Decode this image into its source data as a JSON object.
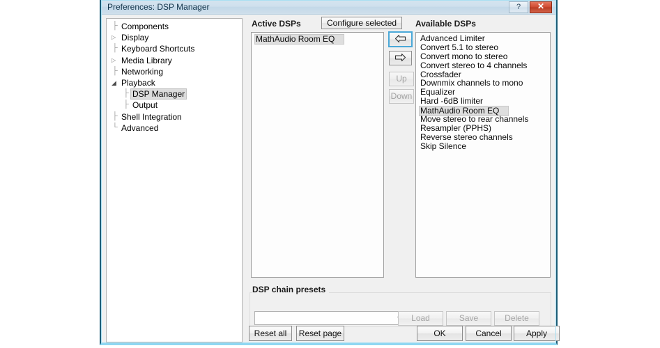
{
  "window": {
    "title": "Preferences: DSP Manager",
    "help_button": "?",
    "close_button": "✕"
  },
  "sidebar": {
    "items": [
      {
        "label": "Components",
        "glyph": "",
        "level": 0,
        "selected": false
      },
      {
        "label": "Display",
        "glyph": "collapsed",
        "level": 0,
        "selected": false
      },
      {
        "label": "Keyboard Shortcuts",
        "glyph": "",
        "level": 0,
        "selected": false
      },
      {
        "label": "Media Library",
        "glyph": "collapsed",
        "level": 0,
        "selected": false
      },
      {
        "label": "Networking",
        "glyph": "",
        "level": 0,
        "selected": false
      },
      {
        "label": "Playback",
        "glyph": "expanded",
        "level": 0,
        "selected": false
      },
      {
        "label": "DSP Manager",
        "glyph": "",
        "level": 1,
        "selected": true
      },
      {
        "label": "Output",
        "glyph": "",
        "level": 1,
        "selected": false
      },
      {
        "label": "Shell Integration",
        "glyph": "",
        "level": 0,
        "selected": false
      },
      {
        "label": "Advanced",
        "glyph": "",
        "level": 0,
        "selected": false
      }
    ]
  },
  "main": {
    "active_dsps": {
      "header": "Active DSPs",
      "configure_button": "Configure selected",
      "items": [
        {
          "label": "MathAudio Room EQ",
          "selected": true
        }
      ]
    },
    "available_dsps": {
      "header": "Available DSPs",
      "items": [
        {
          "label": "Advanced Limiter",
          "selected": false
        },
        {
          "label": "Convert 5.1 to stereo",
          "selected": false
        },
        {
          "label": "Convert mono to stereo",
          "selected": false
        },
        {
          "label": "Convert stereo to 4 channels",
          "selected": false
        },
        {
          "label": "Crossfader",
          "selected": false
        },
        {
          "label": "Downmix channels to mono",
          "selected": false
        },
        {
          "label": "Equalizer",
          "selected": false
        },
        {
          "label": "Hard -6dB limiter",
          "selected": false
        },
        {
          "label": "MathAudio Room EQ",
          "selected": true
        },
        {
          "label": "Move stereo to rear channels",
          "selected": false
        },
        {
          "label": "Resampler (PPHS)",
          "selected": false
        },
        {
          "label": "Reverse stereo channels",
          "selected": false
        },
        {
          "label": "Skip Silence",
          "selected": false
        }
      ]
    },
    "transfer_buttons": {
      "move_left": "",
      "move_right": "",
      "up": "Up",
      "down": "Down"
    },
    "presets": {
      "group_label": "DSP chain presets",
      "combobox_value": "",
      "load": "Load",
      "save": "Save",
      "delete": "Delete"
    }
  },
  "footer": {
    "reset_all": "Reset all",
    "reset_page": "Reset page",
    "ok": "OK",
    "cancel": "Cancel",
    "apply": "Apply"
  },
  "colors": {
    "accent": "#4aa8d8",
    "window_border": "#1c5d77",
    "close_button": "#cf4b32",
    "selection": "#dedede"
  }
}
